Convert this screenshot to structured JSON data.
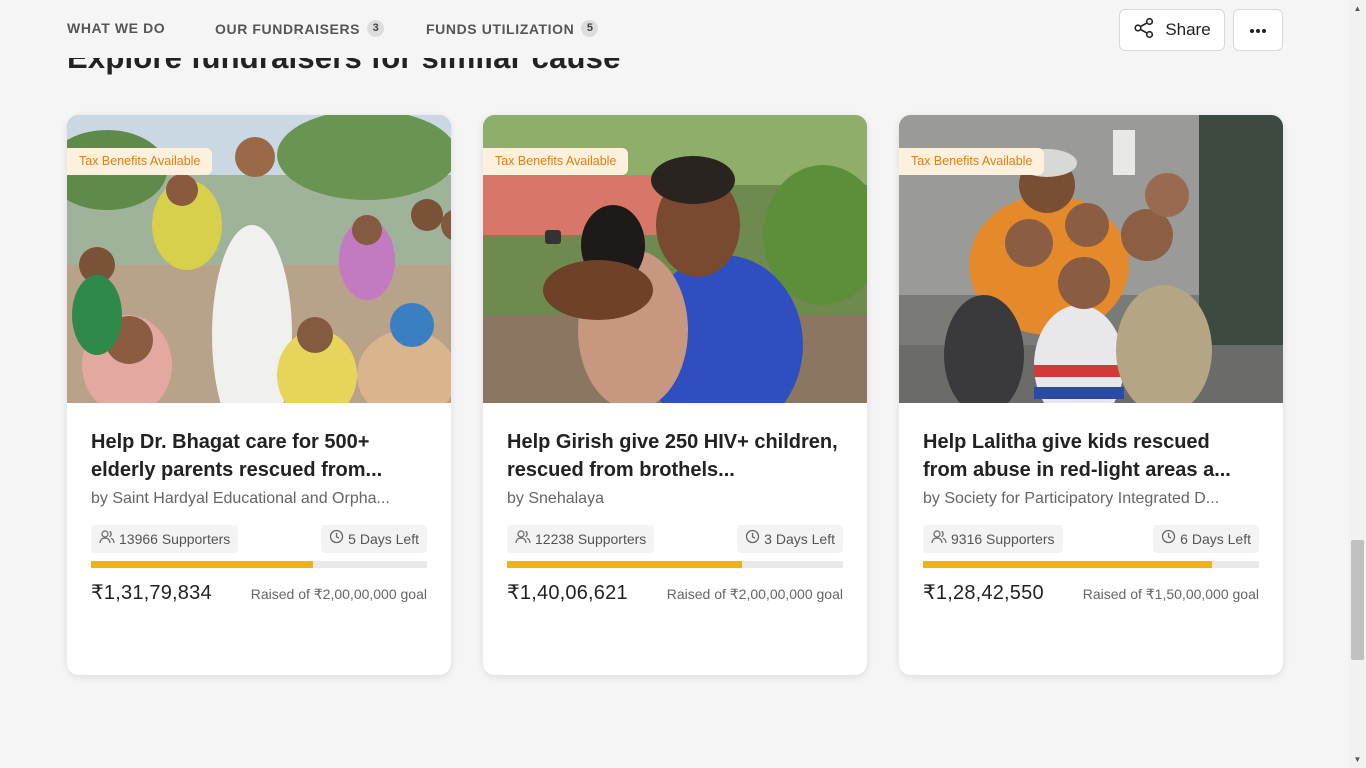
{
  "nav": {
    "tabs": [
      {
        "label": "WHAT WE DO",
        "count": null
      },
      {
        "label": "OUR FUNDRAISERS",
        "count": "3"
      },
      {
        "label": "FUNDS UTILIZATION",
        "count": "5"
      }
    ],
    "share_label": "Share"
  },
  "section": {
    "heading": "Explore fundraisers for similar cause"
  },
  "cards": [
    {
      "badge": "Tax Benefits Available",
      "title": "Help Dr. Bhagat care for 500+ elderly parents rescued from...",
      "org": "by Saint Hardyal Educational and Orpha...",
      "supporters": "13966 Supporters",
      "days_left": "5 Days Left",
      "progress": 0.66,
      "amount": "₹1,31,79,834",
      "goal": "Raised of ₹2,00,00,000 goal"
    },
    {
      "badge": "Tax Benefits Available",
      "title": "Help Girish give 250 HIV+ children, rescued from brothels...",
      "org": "by Snehalaya",
      "supporters": "12238 Supporters",
      "days_left": "3 Days Left",
      "progress": 0.7,
      "amount": "₹1,40,06,621",
      "goal": "Raised of ₹2,00,00,000 goal"
    },
    {
      "badge": "Tax Benefits Available",
      "title": "Help Lalitha give kids rescued from abuse in red-light areas a...",
      "org": "by Society for Participatory Integrated D...",
      "supporters": "9316 Supporters",
      "days_left": "6 Days Left",
      "progress": 0.86,
      "amount": "₹1,28,42,550",
      "goal": "Raised of ₹1,50,00,000 goal"
    }
  ],
  "colors": {
    "accent": "#f0b01a",
    "badge_text": "#e07e10",
    "badge_bg": "#fdf1de",
    "background": "#f5f5f5"
  },
  "icons": {
    "share": "share-icon",
    "more": "more-dots-icon",
    "supporters": "users-icon",
    "days_left": "clock-icon"
  }
}
